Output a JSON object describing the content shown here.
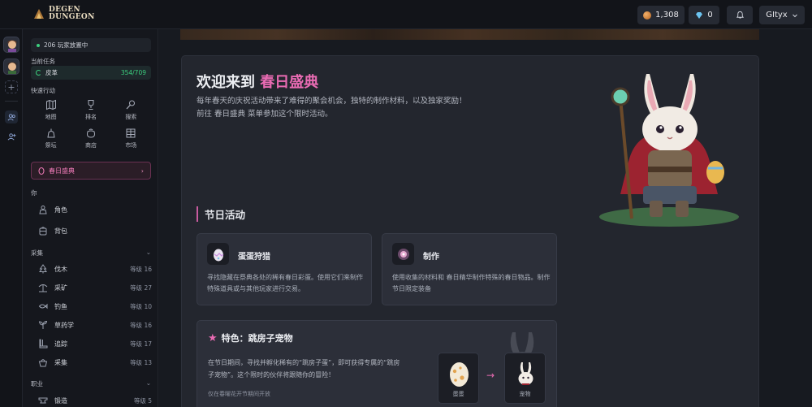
{
  "app": {
    "logo_line1": "DEGEN",
    "logo_line2": "DUNGEON"
  },
  "topbar": {
    "coins": "1,308",
    "gems": "0",
    "username": "GItyx"
  },
  "sidebar": {
    "online": "206 玩家放置中",
    "current_task_label": "当前任务",
    "task": {
      "name": "皮革",
      "progress": "354/709"
    },
    "quick_actions_label": "快速行动",
    "quick_actions": [
      {
        "label": "地图",
        "icon": "map-icon"
      },
      {
        "label": "排名",
        "icon": "trophy-icon"
      },
      {
        "label": "搜索",
        "icon": "search-icon"
      },
      {
        "label": "祭坛",
        "icon": "altar-icon"
      },
      {
        "label": "商店",
        "icon": "bag-icon"
      },
      {
        "label": "市场",
        "icon": "market-icon"
      }
    ],
    "event_button": "春日盛典",
    "you_label": "你",
    "you_items": [
      {
        "label": "角色",
        "icon": "character-icon"
      },
      {
        "label": "背包",
        "icon": "backpack-icon"
      }
    ],
    "gathering_label": "采集",
    "gathering": [
      {
        "label": "伐木",
        "level": "等级 16",
        "icon": "tree-icon"
      },
      {
        "label": "采矿",
        "level": "等级 27",
        "icon": "pickaxe-icon"
      },
      {
        "label": "钓鱼",
        "level": "等级 10",
        "icon": "fishing-icon"
      },
      {
        "label": "草药学",
        "level": "等级 16",
        "icon": "herb-icon"
      },
      {
        "label": "追踪",
        "level": "等级 17",
        "icon": "boot-icon"
      },
      {
        "label": "采集",
        "level": "等级 13",
        "icon": "basket-icon"
      }
    ],
    "profession_label": "职业",
    "profession": [
      {
        "label": "锻造",
        "level": "等级 5",
        "icon": "anvil-icon"
      }
    ]
  },
  "main": {
    "title_prefix": "欢迎来到 ",
    "title_highlight": "春日盛典",
    "description": "每年春天的庆祝活动带来了难得的聚会机会，独特的制作材料，以及独家奖励！前往 春日盛典 菜单参加这个限时活动。",
    "section_title": "节日活动",
    "features": [
      {
        "title": "蛋蛋狩猎",
        "desc": "寻找隐藏在祭典各处的稀有春日彩蛋。使用它们来制作特殊道具或与其他玩家进行交易。",
        "icon": "egg-icon"
      },
      {
        "title": "制作",
        "desc": "使用收集的材料和 春日精华制作特殊的春日物品。制作节日限定装备",
        "icon": "crafting-icon"
      }
    ],
    "pet": {
      "title": "特色：跳房子宠物",
      "desc": "在节日期间，寻找并孵化稀有的“跳房子蛋”，即可获得专属的“跳房子宠物”。这个限时的伙伴将跟随你的冒险！",
      "note": "仅在春曜花开节期间开放",
      "egg_label": "蛋蛋",
      "pet_label": "宠物"
    }
  }
}
